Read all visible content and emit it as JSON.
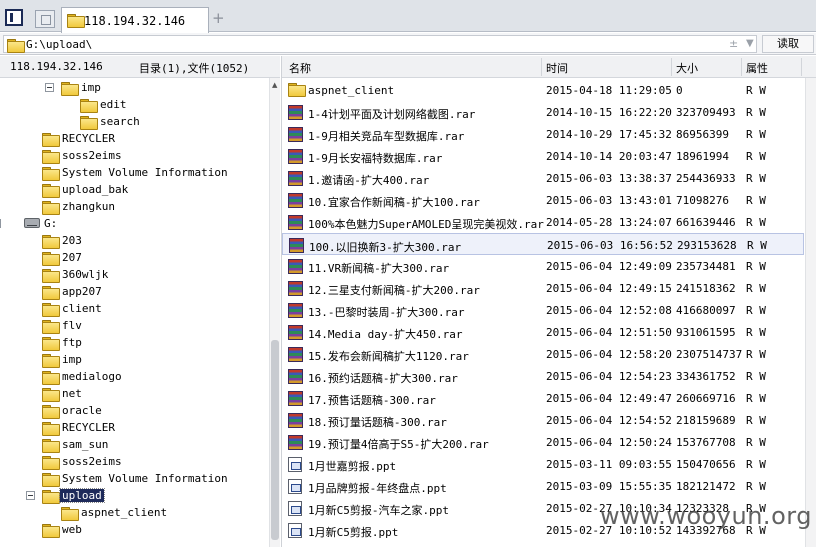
{
  "tab": {
    "label": "118.194.32.146",
    "add_label": "+"
  },
  "path": {
    "value": "G:\\upload\\",
    "read_button": "读取",
    "history_glyph": "±",
    "arrow_glyph": "▼"
  },
  "left_header": {
    "server": "118.194.32.146",
    "counts": "目录(1),文件(1052)"
  },
  "tree": [
    {
      "label": "imp",
      "level": 3,
      "type": "folder",
      "expander": true
    },
    {
      "label": "edit",
      "level": 4,
      "type": "folder"
    },
    {
      "label": "search",
      "level": 4,
      "type": "folder"
    },
    {
      "label": "RECYCLER",
      "level": 2,
      "type": "folder"
    },
    {
      "label": "soss2eims",
      "level": 2,
      "type": "folder"
    },
    {
      "label": "System Volume Information",
      "level": 2,
      "type": "folder"
    },
    {
      "label": "upload_bak",
      "level": 2,
      "type": "folder"
    },
    {
      "label": "zhangkun",
      "level": 2,
      "type": "folder"
    },
    {
      "label": "G:",
      "level": 1,
      "type": "drive",
      "expander": true
    },
    {
      "label": "203",
      "level": 2,
      "type": "folder"
    },
    {
      "label": "207",
      "level": 2,
      "type": "folder"
    },
    {
      "label": "360wljk",
      "level": 2,
      "type": "folder"
    },
    {
      "label": "app207",
      "level": 2,
      "type": "folder"
    },
    {
      "label": "client",
      "level": 2,
      "type": "folder"
    },
    {
      "label": "flv",
      "level": 2,
      "type": "folder"
    },
    {
      "label": "ftp",
      "level": 2,
      "type": "folder"
    },
    {
      "label": "imp",
      "level": 2,
      "type": "folder"
    },
    {
      "label": "medialogo",
      "level": 2,
      "type": "folder"
    },
    {
      "label": "net",
      "level": 2,
      "type": "folder"
    },
    {
      "label": "oracle",
      "level": 2,
      "type": "folder"
    },
    {
      "label": "RECYCLER",
      "level": 2,
      "type": "folder"
    },
    {
      "label": "sam_sun",
      "level": 2,
      "type": "folder"
    },
    {
      "label": "soss2eims",
      "level": 2,
      "type": "folder"
    },
    {
      "label": "System Volume Information",
      "level": 2,
      "type": "folder"
    },
    {
      "label": "upload",
      "level": 2,
      "type": "folder",
      "expander": true,
      "selected": true
    },
    {
      "label": "aspnet_client",
      "level": 3,
      "type": "folder"
    },
    {
      "label": "web",
      "level": 2,
      "type": "folder"
    }
  ],
  "columns": {
    "name": "名称",
    "time": "时间",
    "size": "大小",
    "attr": "属性"
  },
  "files": [
    {
      "type": "folder",
      "name": "aspnet_client",
      "time": "2015-04-18 11:29:05",
      "size": "0",
      "attr": "R W"
    },
    {
      "type": "rar",
      "name": "1-4计划平面及计划网络截图.rar",
      "time": "2014-10-15 16:22:20",
      "size": "323709493",
      "attr": "R W"
    },
    {
      "type": "rar",
      "name": "1-9月相关竞品车型数据库.rar",
      "time": "2014-10-29 17:45:32",
      "size": "86956399",
      "attr": "R W"
    },
    {
      "type": "rar",
      "name": "1-9月长安福特数据库.rar",
      "time": "2014-10-14 20:03:47",
      "size": "18961994",
      "attr": "R W"
    },
    {
      "type": "rar",
      "name": "1.邀请函-扩大400.rar",
      "time": "2015-06-03 13:38:37",
      "size": "254436933",
      "attr": "R W"
    },
    {
      "type": "rar",
      "name": "10.宜家合作新闻稿-扩大100.rar",
      "time": "2015-06-03 13:43:01",
      "size": "71098276",
      "attr": "R W"
    },
    {
      "type": "rar",
      "name": "100%本色魅力SuperAMOLED呈现完美视效.rar",
      "time": "2014-05-28 13:24:07",
      "size": "661639446",
      "attr": "R W"
    },
    {
      "type": "rar",
      "name": "100.以旧换新3-扩大300.rar",
      "time": "2015-06-03 16:56:52",
      "size": "293153628",
      "attr": "R W",
      "highlight": true
    },
    {
      "type": "rar",
      "name": "11.VR新闻稿-扩大300.rar",
      "time": "2015-06-04 12:49:09",
      "size": "235734481",
      "attr": "R W"
    },
    {
      "type": "rar",
      "name": "12.三星支付新闻稿-扩大200.rar",
      "time": "2015-06-04 12:49:15",
      "size": "241518362",
      "attr": "R W"
    },
    {
      "type": "rar",
      "name": "13.-巴黎时装周-扩大300.rar",
      "time": "2015-06-04 12:52:08",
      "size": "416680097",
      "attr": "R W"
    },
    {
      "type": "rar",
      "name": "14.Media day-扩大450.rar",
      "time": "2015-06-04 12:51:50",
      "size": "931061595",
      "attr": "R W"
    },
    {
      "type": "rar",
      "name": "15.发布会新闻稿扩大1120.rar",
      "time": "2015-06-04 12:58:20",
      "size": "2307514737",
      "attr": "R W"
    },
    {
      "type": "rar",
      "name": "16.预约话题稿-扩大300.rar",
      "time": "2015-06-04 12:54:23",
      "size": "334361752",
      "attr": "R W"
    },
    {
      "type": "rar",
      "name": "17.预售话题稿-300.rar",
      "time": "2015-06-04 12:49:47",
      "size": "260669716",
      "attr": "R W"
    },
    {
      "type": "rar",
      "name": "18.预订量话题稿-300.rar",
      "time": "2015-06-04 12:54:52",
      "size": "218159689",
      "attr": "R W"
    },
    {
      "type": "rar",
      "name": "19.预订量4倍高于S5-扩大200.rar",
      "time": "2015-06-04 12:50:24",
      "size": "153767708",
      "attr": "R W"
    },
    {
      "type": "ppt",
      "name": "1月世嘉剪报.ppt",
      "time": "2015-03-11 09:03:55",
      "size": "150470656",
      "attr": "R W"
    },
    {
      "type": "ppt",
      "name": "1月品牌剪报-年终盘点.ppt",
      "time": "2015-03-09 15:55:35",
      "size": "182121472",
      "attr": "R W"
    },
    {
      "type": "ppt",
      "name": "1月新C5剪报-汽车之家.ppt",
      "time": "2015-02-27 10:10:34",
      "size": "12323328",
      "attr": "R W"
    },
    {
      "type": "ppt",
      "name": "1月新C5剪报.ppt",
      "time": "2015-02-27 10:10:52",
      "size": "143392768",
      "attr": "R W"
    }
  ],
  "watermark": "www.wooyun.org"
}
